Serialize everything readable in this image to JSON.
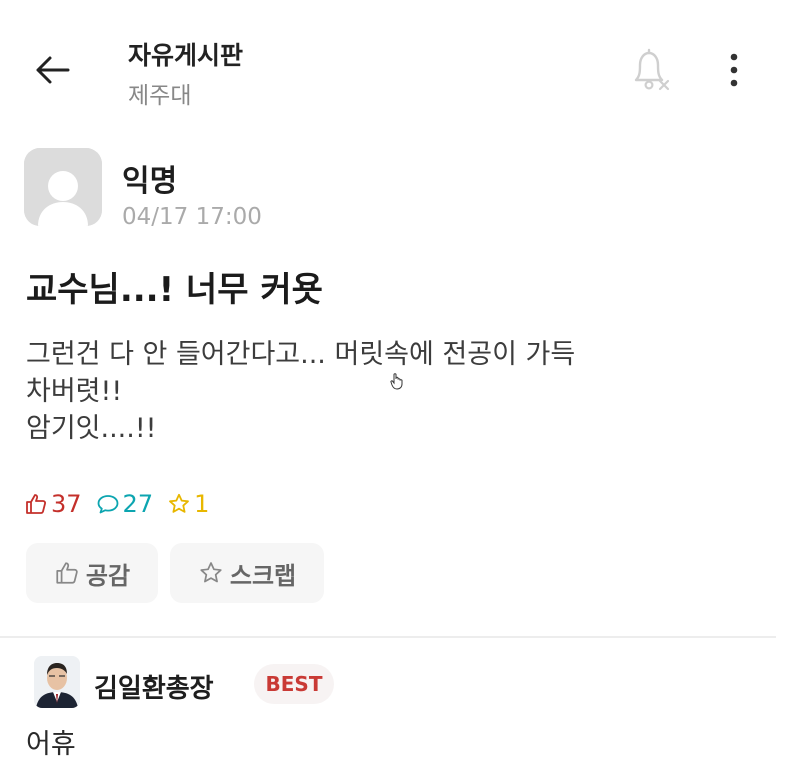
{
  "header": {
    "back_icon": "arrow-left-icon",
    "board_title": "자유게시판",
    "school": "제주대",
    "bell_icon": "bell-off-icon",
    "more_icon": "more-vertical-icon"
  },
  "post": {
    "author": "익명",
    "time": "04/17 17:00",
    "title": "교수님...! 너무 커욧",
    "body": [
      "그런건 다 안 들어간다고... 머릿속에 전공이 가득",
      "차버렷!!",
      "암기잇....!!"
    ]
  },
  "stats": {
    "likes": "37",
    "comments": "27",
    "scraps": "1",
    "like_color": "#c4302b",
    "comment_color": "#0ca5b0",
    "scrap_color": "#e8b700"
  },
  "actions": {
    "empathy_label": "공감",
    "scrap_label": "스크랩"
  },
  "comment": {
    "author": "김일환총장",
    "badge": "BEST",
    "text": "어휴"
  }
}
